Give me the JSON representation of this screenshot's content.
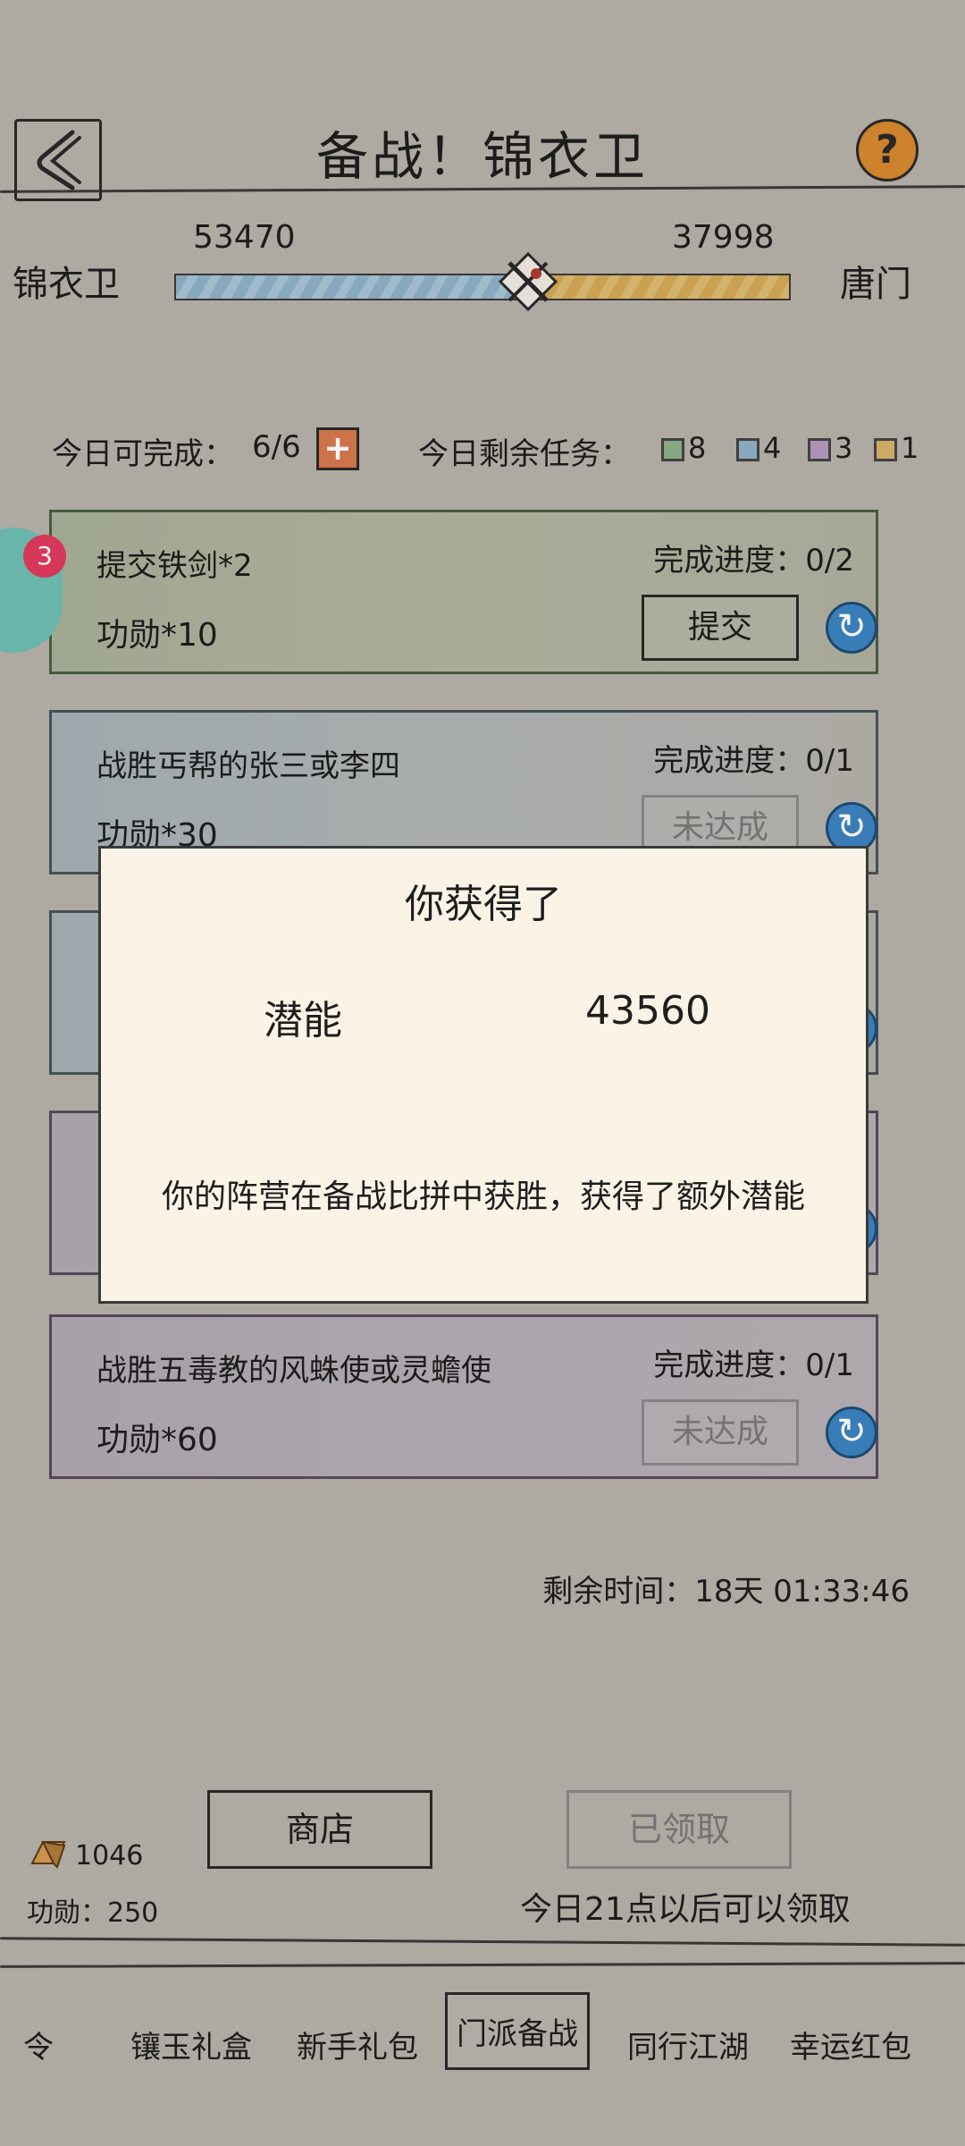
{
  "header": {
    "title": "备战！锦衣卫"
  },
  "factions": {
    "left": {
      "name": "锦衣卫",
      "score": "53470",
      "color": "#8fb1c8"
    },
    "right": {
      "name": "唐门",
      "score": "37998",
      "color": "#d4aa55"
    },
    "left_share": 0.574
  },
  "daily": {
    "can_complete_label": "今日可完成：",
    "can_complete_value": "6/6",
    "remaining_label": "今日剩余任务：",
    "counts": [
      {
        "color": "#8fb08a",
        "value": "8"
      },
      {
        "color": "#8fb2c8",
        "value": "4"
      },
      {
        "color": "#b79ac0",
        "value": "3"
      },
      {
        "color": "#d9b36a",
        "value": "1"
      }
    ]
  },
  "badge": "3",
  "tasks": [
    {
      "title": "提交铁剑*2",
      "reward": "功勋*10",
      "progress": "完成进度：0/2",
      "button": "提交"
    },
    {
      "title": "战胜丐帮的张三或李四",
      "reward": "功勋*30",
      "progress": "完成进度：0/1",
      "button": "未达成"
    },
    {
      "title": "战胜五毒教的风蛛使或灵蟾使",
      "reward": "功勋*60",
      "progress": "完成进度：0/1",
      "button": "未达成"
    }
  ],
  "modal": {
    "title": "你获得了",
    "item_name": "潜能",
    "item_value": "43560",
    "message": "你的阵营在备战比拼中获胜，获得了额外潜能"
  },
  "remaining_time": "剩余时间：18天 01:33:46",
  "bottom": {
    "shop_label": "商店",
    "claimed_label": "已领取",
    "claim_note": "今日21点以后可以领取",
    "resource_count": "1046",
    "merit_label": "功勋：250"
  },
  "tabs": [
    "令",
    "镶玉礼盒",
    "新手礼包",
    "门派备战",
    "同行江湖",
    "幸运红包"
  ],
  "active_tab": "门派备战"
}
